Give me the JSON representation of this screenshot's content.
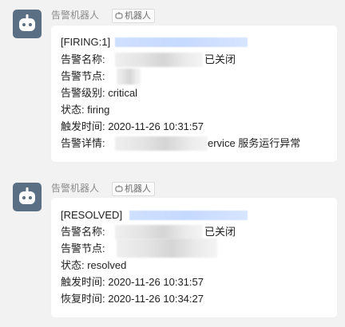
{
  "messages": [
    {
      "sender": "告警机器人",
      "bot_tag": "机器人",
      "title": "[FIRING:1]",
      "rows": [
        {
          "text": "告警名称:",
          "tail": "已关闭"
        },
        {
          "text": "告警节点:",
          "tail": ""
        },
        {
          "text": "告警级别: critical",
          "tail": ""
        },
        {
          "text": "状态: firing",
          "tail": ""
        },
        {
          "text": "触发时间: 2020-11-26 10:31:57",
          "tail": ""
        },
        {
          "text": "告警详情:",
          "tail": "ervice 服务运行异常"
        }
      ]
    },
    {
      "sender": "告警机器人",
      "bot_tag": "机器人",
      "title": "[RESOLVED]",
      "rows": [
        {
          "text": "告警名称:",
          "tail": "已关闭"
        },
        {
          "text": "告警节点:",
          "tail": ""
        },
        {
          "text": "状态: resolved",
          "tail": ""
        },
        {
          "text": "触发时间: 2020-11-26 10:31:57",
          "tail": ""
        },
        {
          "text": "恢复时间: 2020-11-26 10:34:27",
          "tail": ""
        }
      ]
    }
  ],
  "colors": {
    "avatar": "#5b6f84",
    "background": "#f2f2f2",
    "card": "#ffffff",
    "redacted_link": "#c6d9ff"
  }
}
